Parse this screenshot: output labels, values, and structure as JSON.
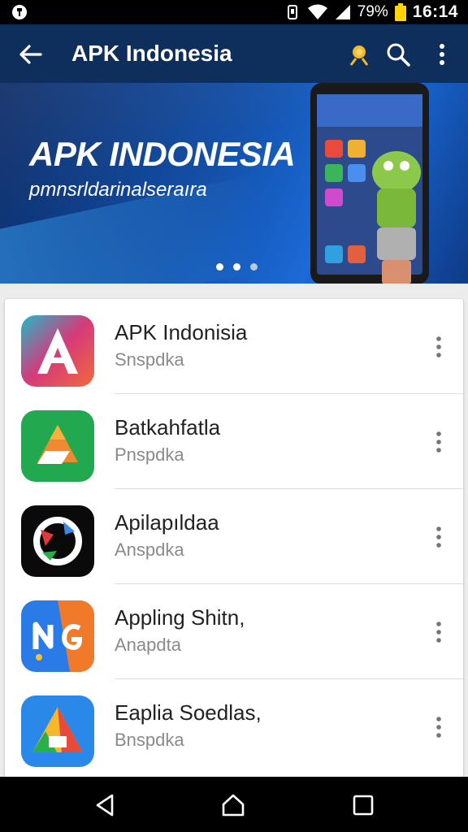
{
  "status_bar": {
    "battery_percent": "79%",
    "time": "16:14",
    "icons": [
      "app-notification-icon",
      "vibrate-icon",
      "wifi-icon",
      "signal-icon",
      "battery-icon"
    ]
  },
  "app_bar": {
    "title": "APK Indonesia",
    "icons": [
      "back-arrow-icon",
      "coin-icon",
      "search-icon",
      "more-vert-icon"
    ]
  },
  "banner": {
    "heading": "APK INDONESIA",
    "subheading": "pmnsrldarinalseraıra",
    "slide_count": 3,
    "active_slide": 2
  },
  "apps": [
    {
      "name": "APK Indonisia",
      "subtitle": "Snspdka"
    },
    {
      "name": "Batkahfatla",
      "subtitle": "Pnspdka"
    },
    {
      "name": "Apilapıldaa",
      "subtitle": "Anspdka"
    },
    {
      "name": "Appling Shitn,",
      "subtitle": "Anapdta"
    },
    {
      "name": "Eaplia Soedlas,",
      "subtitle": "Bnspdka"
    }
  ],
  "colors": {
    "app_bar": "#0e2f5c",
    "banner": "#1450a8"
  }
}
